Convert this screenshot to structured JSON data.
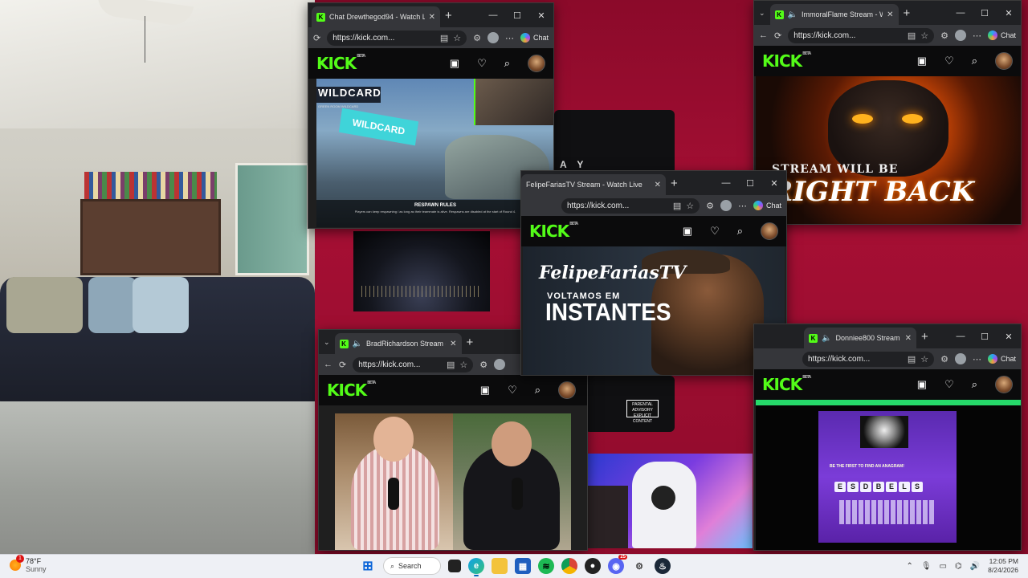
{
  "desktop": {
    "wall_text": "A Y",
    "advisory": "PARENTAL ADVISORY EXPLICIT CONTENT"
  },
  "windows": [
    {
      "id": "drewthegod",
      "tab_title": "Chat Drewthegod94 - Watch L",
      "url": "https://kick.com...",
      "chat_label": "Chat",
      "stream": {
        "banner": "WILDCARD",
        "sub": "GREEN ROOM WILDCARD",
        "sign": "WILDCARD",
        "rules_title": "RESPAWN RULES",
        "rules_text": "Players can keep respawning / as long as their teammate is alive. Respawns are disabled at the start of Round 4."
      }
    },
    {
      "id": "immoralflame",
      "tab_title": "ImmoralFlame Stream - Watch",
      "url": "https://kick.com...",
      "chat_label": "Chat",
      "stream": {
        "line1": "STREAM WILL BE",
        "line2": "RIGHT BACK"
      }
    },
    {
      "id": "felipefarias",
      "tab_title": "FelipeFariasTV Stream - Watch Live",
      "url": "https://kick.com...",
      "chat_label": "Chat",
      "stream": {
        "name": "FelipeFariasTV",
        "line1": "VOLTAMOS EM",
        "line2": "INSTANTES"
      }
    },
    {
      "id": "bradrichardson",
      "tab_title": "BradRichardson Stream - Watch",
      "url": "https://kick.com...",
      "stream": {}
    },
    {
      "id": "donniee800",
      "tab_title": "Donniee800 Stream",
      "url": "https://kick.com...",
      "chat_label": "Chat",
      "stream": {
        "title": "BE THE FIRST TO FIND AN ANAGRAM!",
        "letters": [
          "E",
          "S",
          "D",
          "B",
          "E",
          "L",
          "S"
        ]
      }
    }
  ],
  "kick": {
    "logo": "KICK",
    "beta": "BETA"
  },
  "taskbar": {
    "weather_temp": "78°F",
    "weather_cond": "Sunny",
    "weather_badge": "1",
    "search_label": "Search",
    "discord_badge": "25",
    "time": "12:05 PM",
    "date": "8/24/2026"
  },
  "colors": {
    "kick_green": "#53fc18",
    "wallpaper": "#a60f34"
  }
}
